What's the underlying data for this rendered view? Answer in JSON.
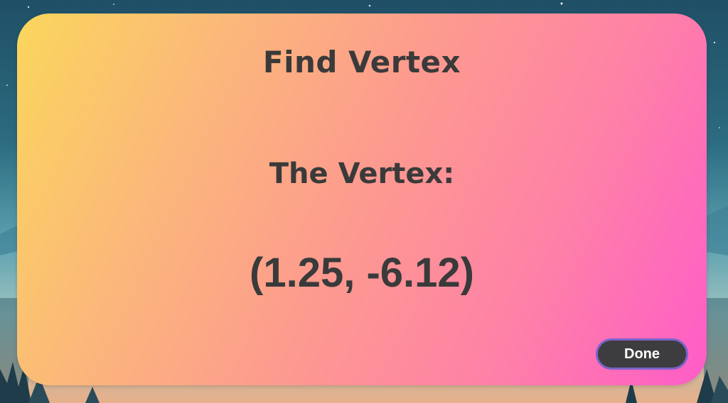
{
  "dialog": {
    "title": "Find Vertex",
    "label": "The Vertex:",
    "value": "(1.25, -6.12)",
    "done_label": "Done"
  },
  "colors": {
    "card_gradient_start": "#fbd65c",
    "card_gradient_end": "#ff5cc8",
    "text": "#3a3a3a",
    "button_bg": "#3d3d3f",
    "button_border": "#7a63c9"
  }
}
